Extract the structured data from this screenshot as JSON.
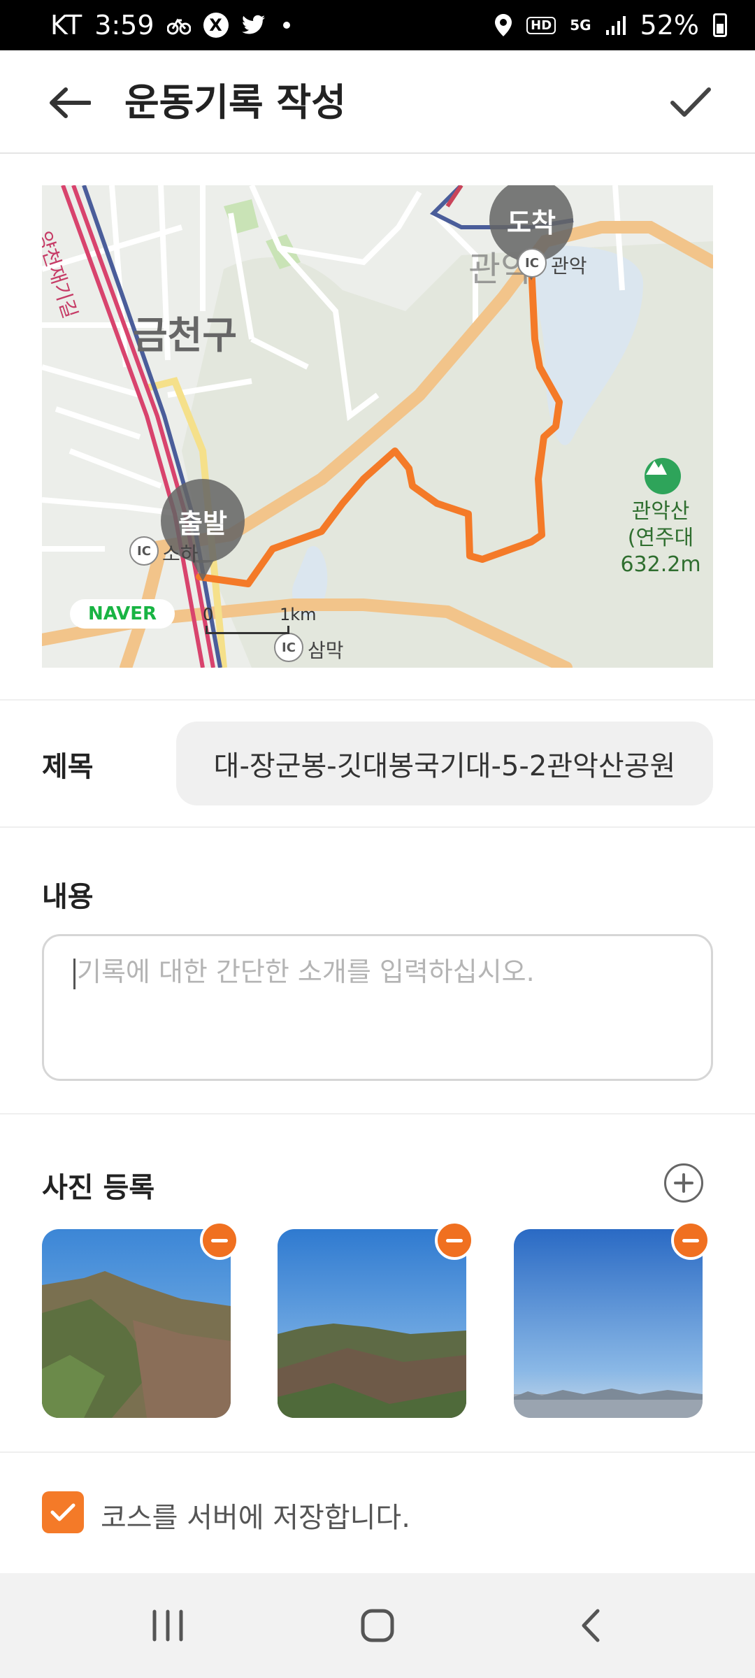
{
  "status_bar": {
    "carrier": "KT",
    "time": "3:59",
    "network": "5G",
    "hd": "HD",
    "battery": "52%"
  },
  "header": {
    "title": "운동기록 작성",
    "back_icon": "arrow-left-icon",
    "confirm_icon": "check-icon"
  },
  "map": {
    "district": "금천구",
    "road_label": "양천재기길",
    "start_label": "출발",
    "end_label": "도착",
    "place_start": "소하",
    "place_end": "관악",
    "place_end_area": "관악",
    "place_bottom": "삼막",
    "ic": "IC",
    "naver": "NAVER",
    "scale_zero": "0",
    "scale_unit": "1km",
    "mountain_name": "관악산",
    "mountain_detail": "(연주대632.2m",
    "route_color": "#f47a28"
  },
  "form": {
    "title_label": "제목",
    "title_value": "대-장군봉-깃대봉국기대-5-2관악산공원",
    "content_label": "내용",
    "content_placeholder": "기록에 대한 간단한 소개를 입력하십시오.",
    "photo_label": "사진 등록",
    "photos": [
      {
        "name": "mountain-photo-1"
      },
      {
        "name": "mountain-photo-2"
      },
      {
        "name": "sky-photo-3"
      }
    ],
    "save_course_label": "코스를 서버에 저장합니다.",
    "save_course_checked": true
  },
  "nav": {
    "recent": "recent-apps-icon",
    "home": "home-icon",
    "back": "back-icon"
  }
}
